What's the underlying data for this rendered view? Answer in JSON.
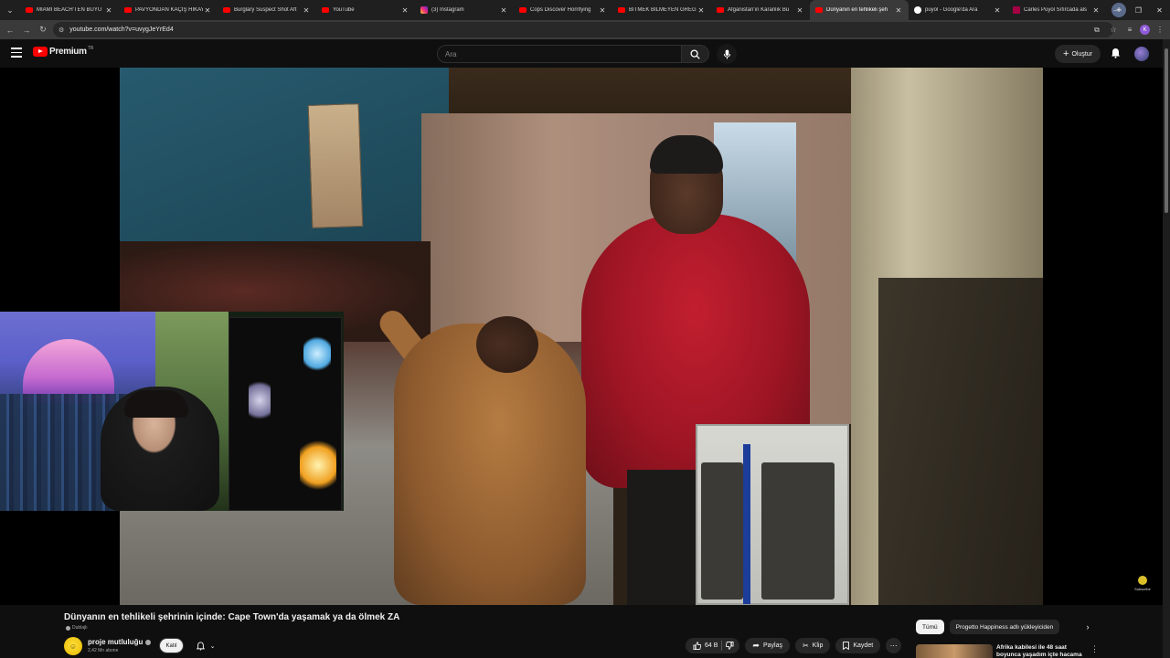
{
  "browser": {
    "tabs": [
      {
        "label": "MIAMI BEACH'TEN BÜYÜ",
        "favicon": "youtube",
        "active": false
      },
      {
        "label": "PAVYONDAN KAÇIŞ HİKAYE",
        "favicon": "youtube",
        "active": false
      },
      {
        "label": "Burglary Suspect Shot Aft",
        "favicon": "youtube",
        "active": false
      },
      {
        "label": "YouTube",
        "favicon": "youtube",
        "active": false
      },
      {
        "label": "(3) Instagram",
        "favicon": "instagram",
        "active": false
      },
      {
        "label": "Cops Discover Horrifying",
        "favicon": "youtube",
        "active": false
      },
      {
        "label": "BİTMEK BİLMEYEN GREG",
        "favicon": "youtube",
        "active": false
      },
      {
        "label": "Afganistan'ın Karanlık Bu",
        "favicon": "youtube",
        "active": false
      },
      {
        "label": "Dünyanın en tehlikeli şeh",
        "favicon": "youtube",
        "active": true
      },
      {
        "label": "puyol - Google'da Ara",
        "favicon": "google",
        "active": false
      },
      {
        "label": "Carles Puyol Sıfırcada als",
        "favicon": "fcb",
        "active": false
      }
    ],
    "url": "youtube.com/watch?v=uvygJeYrEd4",
    "profile_initial": "K"
  },
  "masthead": {
    "logo_text": "Premium",
    "country_code": "TR",
    "search_placeholder": "Ara",
    "create_label": "Oluştur"
  },
  "video": {
    "title": "Dünyanın en tehlikeli şehrinin içinde: Cape Town'da yaşamak ya da ölmek ZA",
    "dubbed_label": "Dublajlı",
    "watermark_label": "Subscribe"
  },
  "channel": {
    "name": "proje mutluluğu",
    "subscribers": "2,42 Mn abone",
    "join_label": "Katıl"
  },
  "actions": {
    "likes": "64 B",
    "share_label": "Paylaş",
    "clip_label": "Klip",
    "save_label": "Kaydet"
  },
  "chips": [
    {
      "label": "Tümü",
      "active": true
    },
    {
      "label": "Progetto Happiness adlı yükleyiciden",
      "active": false
    }
  ],
  "recommendation": {
    "title": "Afrika kabilesi ile 48 saat boyunca yaşadım içte hacama"
  },
  "colors": {
    "brand_red": "#ff0000",
    "background": "#0f0f0f",
    "chip_bg": "#272727"
  }
}
